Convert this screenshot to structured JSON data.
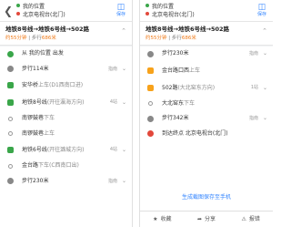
{
  "route": {
    "from": "我的位置",
    "to": "北京电视台(北门)",
    "save_label": "保存",
    "title": "地铁8号线→地铁6号线→502路",
    "time": "约55分钟",
    "walk_prefix": "步行",
    "walk_dist": "686米"
  },
  "left_steps": [
    {
      "text": "从 我的位置 出发",
      "kind": "start"
    },
    {
      "text": "步行114米",
      "kind": "walk",
      "tag": "指南"
    },
    {
      "text": "安华桥",
      "sub": "上车(D1西南口进)",
      "kind": "subway"
    },
    {
      "text": "地铁8号线",
      "sub": "(开往瀛海方向)",
      "kind": "subway",
      "tag": "4站"
    },
    {
      "text": "南锣鼓巷",
      "sub": "下车",
      "kind": "stop"
    },
    {
      "text": "南锣鼓巷",
      "sub": "上车",
      "kind": "stop"
    },
    {
      "text": "地铁6号线",
      "sub": "(开往潞城方向)",
      "kind": "subway",
      "tag": "4站"
    },
    {
      "text": "金台路",
      "sub": "下车(C西南口出)",
      "kind": "stop"
    },
    {
      "text": "步行230米",
      "kind": "walk",
      "tag": "指南"
    }
  ],
  "right_steps": [
    {
      "text": "步行230米",
      "kind": "walk",
      "tag": "指南"
    },
    {
      "text": "金台路口西",
      "sub": "上车",
      "kind": "bus"
    },
    {
      "text": "502路",
      "sub": "(大北窑东方向)",
      "kind": "bus",
      "tag": "1站"
    },
    {
      "text": "大北窑东",
      "sub": "下车",
      "kind": "stop"
    },
    {
      "text": "步行342米",
      "kind": "walk",
      "tag": "指南"
    },
    {
      "text": "到达终点 北京电视台(北门)",
      "kind": "end"
    }
  ],
  "generate_button": "生成截图保存至手机",
  "bottom": {
    "collect": "收藏",
    "share": "分享",
    "report": "报错"
  },
  "colors": {
    "subway_line_8": "#3aa64a",
    "subway_line_6": "#b5335b",
    "bus": "#f7a21b",
    "accent": "#3385ff",
    "time_highlight": "#f07a18"
  }
}
